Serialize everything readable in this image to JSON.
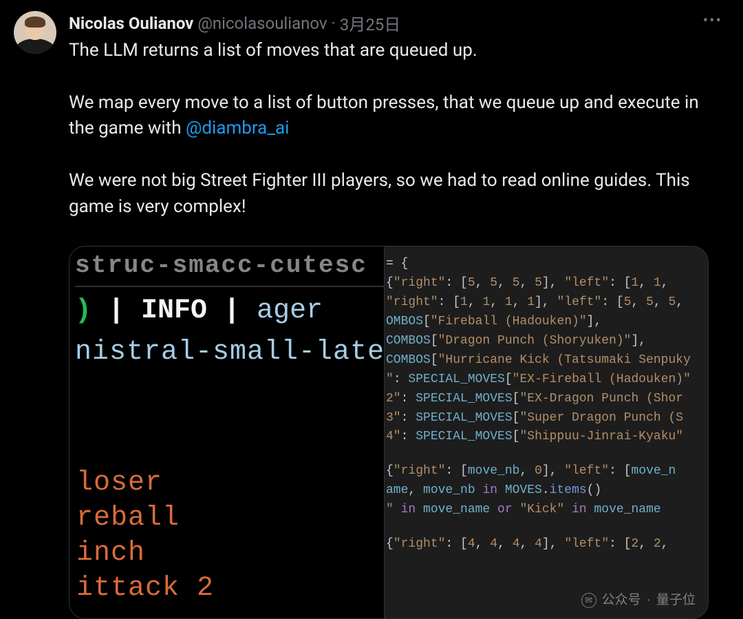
{
  "tweet": {
    "author": {
      "display_name": "Nicolas Oulianov",
      "handle": "@nicolasoulianov",
      "date": "3月25日"
    },
    "body": {
      "p1": "The LLM returns a list of moves that are queued up.",
      "p2a": "We map every move to a list of button presses, that we  queue up and execute in the game with ",
      "mention": "@diambra_ai",
      "p3": "We were not big Street Fighter III players, so we had to read online guides. This game is very complex!"
    }
  },
  "terminal": {
    "line0": "struc-smacc-cutesc",
    "line1_green": ")",
    "line1_pipe1": " | ",
    "line1_info": "INFO",
    "line1_pipe2": "     | ",
    "line1_ager": "ager",
    "line2": "nistral-small-lates",
    "bottom": [
      "loser",
      "reball",
      "inch",
      "ittack 2"
    ]
  },
  "code": {
    "lines": [
      [
        [
          "op",
          "= {"
        ]
      ],
      [
        [
          "br",
          " {"
        ],
        [
          "str",
          "\"right\""
        ],
        [
          "op",
          ": ["
        ],
        [
          "num",
          "5"
        ],
        [
          "op",
          ", "
        ],
        [
          "num",
          "5"
        ],
        [
          "op",
          ", "
        ],
        [
          "num",
          "5"
        ],
        [
          "op",
          ", "
        ],
        [
          "num",
          "5"
        ],
        [
          "op",
          "], "
        ],
        [
          "str",
          "\"left\""
        ],
        [
          "op",
          ": ["
        ],
        [
          "num",
          "1"
        ],
        [
          "op",
          ", "
        ],
        [
          "num",
          "1"
        ],
        [
          "op",
          ","
        ]
      ],
      [
        [
          "str",
          "\"right\""
        ],
        [
          "op",
          ": ["
        ],
        [
          "num",
          "1"
        ],
        [
          "op",
          ", "
        ],
        [
          "num",
          "1"
        ],
        [
          "op",
          ", "
        ],
        [
          "num",
          "1"
        ],
        [
          "op",
          ", "
        ],
        [
          "num",
          "1"
        ],
        [
          "op",
          "], "
        ],
        [
          "str",
          "\"left\""
        ],
        [
          "op",
          ": ["
        ],
        [
          "num",
          "5"
        ],
        [
          "op",
          ", "
        ],
        [
          "num",
          "5"
        ],
        [
          "op",
          ", "
        ],
        [
          "num",
          "5"
        ],
        [
          "op",
          ","
        ]
      ],
      [
        [
          "var",
          "OMBOS"
        ],
        [
          "op",
          "["
        ],
        [
          "str",
          "\"Fireball (Hadouken)\""
        ],
        [
          "op",
          "],"
        ]
      ],
      [
        [
          "var",
          "COMBOS"
        ],
        [
          "op",
          "["
        ],
        [
          "str",
          "\"Dragon Punch (Shoryuken)\""
        ],
        [
          "op",
          "],"
        ]
      ],
      [
        [
          "var",
          "COMBOS"
        ],
        [
          "op",
          "["
        ],
        [
          "str",
          "\"Hurricane Kick (Tatsumaki Senpuky"
        ]
      ],
      [
        [
          "str",
          "\""
        ],
        [
          "op",
          ": "
        ],
        [
          "var",
          "SPECIAL_MOVES"
        ],
        [
          "op",
          "["
        ],
        [
          "str",
          "\"EX-Fireball (Hadouken)\""
        ]
      ],
      [
        [
          "str",
          "2\""
        ],
        [
          "op",
          ": "
        ],
        [
          "var",
          "SPECIAL_MOVES"
        ],
        [
          "op",
          "["
        ],
        [
          "str",
          "\"EX-Dragon Punch (Shor"
        ]
      ],
      [
        [
          "str",
          "3\""
        ],
        [
          "op",
          ": "
        ],
        [
          "var",
          "SPECIAL_MOVES"
        ],
        [
          "op",
          "["
        ],
        [
          "str",
          "\"Super Dragon Punch (S"
        ]
      ],
      [
        [
          "str",
          "4\""
        ],
        [
          "op",
          ": "
        ],
        [
          "var",
          "SPECIAL_MOVES"
        ],
        [
          "op",
          "["
        ],
        [
          "str",
          "\"Shippuu-Jinrai-Kyaku\""
        ]
      ],
      "gap",
      [
        [
          "br",
          " {"
        ],
        [
          "str",
          "\"right\""
        ],
        [
          "op",
          ": ["
        ],
        [
          "var",
          "move_nb"
        ],
        [
          "op",
          ", "
        ],
        [
          "num",
          "0"
        ],
        [
          "op",
          "], "
        ],
        [
          "str",
          "\"left\""
        ],
        [
          "op",
          ": ["
        ],
        [
          "var",
          "move_n"
        ]
      ],
      [
        [
          "var",
          "ame"
        ],
        [
          "op",
          ", "
        ],
        [
          "var",
          "move_nb "
        ],
        [
          "kw",
          "in "
        ],
        [
          "var",
          "MOVES"
        ],
        [
          "op",
          "."
        ],
        [
          "func",
          "items"
        ],
        [
          "op",
          "()"
        ]
      ],
      [
        [
          "str",
          "\" "
        ],
        [
          "kw",
          "in "
        ],
        [
          "var",
          "move_name "
        ],
        [
          "kw",
          "or "
        ],
        [
          "str",
          "\"Kick\" "
        ],
        [
          "kw",
          "in "
        ],
        [
          "var",
          "move_name"
        ]
      ],
      "gap",
      [
        [
          "br",
          " {"
        ],
        [
          "str",
          "\"right\""
        ],
        [
          "op",
          ": ["
        ],
        [
          "num",
          "4"
        ],
        [
          "op",
          ", "
        ],
        [
          "num",
          "4"
        ],
        [
          "op",
          ", "
        ],
        [
          "num",
          "4"
        ],
        [
          "op",
          ", "
        ],
        [
          "num",
          "4"
        ],
        [
          "op",
          "], "
        ],
        [
          "str",
          "\"left\""
        ],
        [
          "op",
          ": ["
        ],
        [
          "num",
          "2"
        ],
        [
          "op",
          ", "
        ],
        [
          "num",
          "2"
        ],
        [
          "op",
          ","
        ]
      ]
    ]
  },
  "watermark": {
    "label": "公众号",
    "sep": "·",
    "name": "量子位"
  }
}
